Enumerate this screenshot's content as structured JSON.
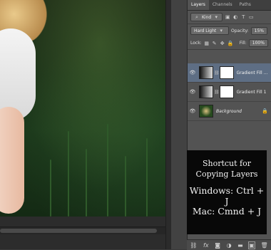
{
  "panel": {
    "tabs": [
      {
        "label": "Layers",
        "active": true
      },
      {
        "label": "Channels",
        "active": false
      },
      {
        "label": "Paths",
        "active": false
      }
    ],
    "filter": {
      "label": "Kind"
    },
    "blend_mode": "Hard Light",
    "opacity_label": "Opacity:",
    "opacity_value": "15%",
    "lock_label": "Lock:",
    "fill_label": "Fill:",
    "fill_value": "100%",
    "layers": [
      {
        "name": "Gradient Fill ...",
        "selected": true
      },
      {
        "name": "Gradient Fill 1",
        "selected": false
      },
      {
        "name": "Background",
        "selected": false
      }
    ]
  },
  "overlay": {
    "line1": "Shortcut for",
    "line2": "Copying Layers",
    "line3": "Windows: Ctrl + J",
    "line4": "Mac: Cmnd + J"
  },
  "colors": {
    "panel_bg": "#535353",
    "selected_layer": "#5e6e84",
    "overlay_bg": "#080808"
  },
  "icons": [
    "eye-icon",
    "link-icon",
    "fx-icon",
    "mask-icon",
    "adjustment-icon",
    "folder-icon",
    "new-layer-icon",
    "trash-icon",
    "lock-icon"
  ]
}
